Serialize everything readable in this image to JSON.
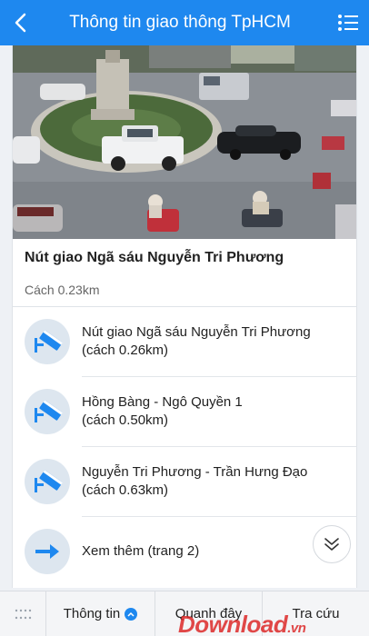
{
  "header": {
    "title": "Thông tin giao thông TpHCM"
  },
  "camera": {
    "title": "Nút giao Ngã sáu Nguyễn Tri Phương",
    "distance": "Cách 0.23km"
  },
  "list": [
    {
      "name": "Nút giao Ngã sáu Nguyễn Tri Phương",
      "distance": "(cách 0.26km)",
      "icon": "camera-icon"
    },
    {
      "name": "Hồng Bàng - Ngô Quyền 1",
      "distance": "(cách 0.50km)",
      "icon": "camera-icon"
    },
    {
      "name": "Nguyễn Tri Phương - Trần Hưng Đạo",
      "distance": "(cách 0.63km)",
      "icon": "camera-icon"
    }
  ],
  "more": {
    "label": "Xem thêm (trang 2)",
    "icon": "arrow-right-icon"
  },
  "tabs": {
    "info": "Thông tin",
    "nearby": "Quanh đây",
    "search": "Tra cứu"
  },
  "watermark": {
    "text": "Download",
    "suffix": ".vn"
  },
  "colors": {
    "accent": "#1e88ef",
    "icon_bg": "#dde6ef",
    "watermark": "#dc2828"
  }
}
